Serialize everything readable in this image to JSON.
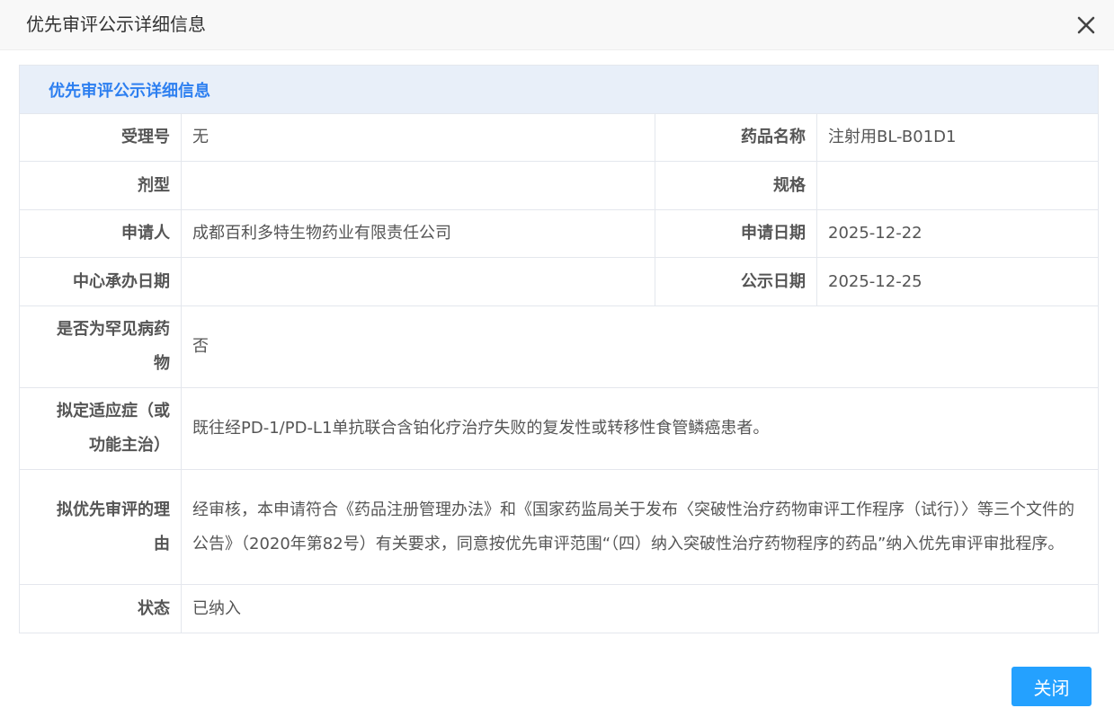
{
  "dialog": {
    "title": "优先审评公示详细信息",
    "close_icon": "close-x-icon",
    "close_button_label": "关闭"
  },
  "section": {
    "title": "优先审评公示详细信息"
  },
  "fields": {
    "acceptance_no": {
      "label": "受理号",
      "value": "无"
    },
    "drug_name": {
      "label": "药品名称",
      "value": "注射用BL-B01D1"
    },
    "dosage_form": {
      "label": "剂型",
      "value": ""
    },
    "specification": {
      "label": "规格",
      "value": ""
    },
    "applicant": {
      "label": "申请人",
      "value": "成都百利多特生物药业有限责任公司"
    },
    "application_date": {
      "label": "申请日期",
      "value": "2025-12-22"
    },
    "center_date": {
      "label": "中心承办日期",
      "value": ""
    },
    "publicity_date": {
      "label": "公示日期",
      "value": "2025-12-25"
    },
    "rare_disease": {
      "label": "是否为罕见病药物",
      "value": "否"
    },
    "indication": {
      "label": "拟定适应症（或功能主治）",
      "value": "既往经PD-1/PD-L1单抗联合含铂化疗治疗失败的复发性或转移性食管鳞癌患者。"
    },
    "reason": {
      "label": "拟优先审评的理由",
      "value": "经审核，本申请符合《药品注册管理办法》和《国家药监局关于发布〈突破性治疗药物审评工作程序（试行）〉等三个文件的公告》（2020年第82号）有关要求，同意按优先审评范围“（四）纳入突破性治疗药物程序的药品”纳入优先审评审批程序。"
    },
    "status": {
      "label": "状态",
      "value": "已纳入"
    }
  },
  "colors": {
    "accent": "#2d7ff0",
    "section_bg": "#e8eff9",
    "button_bg": "#24a1ff",
    "border": "#e4e7ed"
  }
}
